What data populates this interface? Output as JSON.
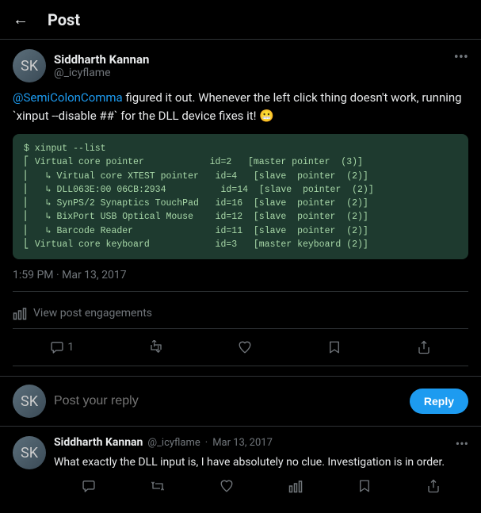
{
  "header": {
    "back_label": "←",
    "title": "Post"
  },
  "main_post": {
    "author": {
      "name": "Siddharth Kannan",
      "handle": "@_icyflame",
      "avatar_initial": "SK"
    },
    "more_icon": "•••",
    "content_prefix": "",
    "mention": "@SemiColonComma",
    "content_text": " figured it out. Whenever the left click thing doesn't work, running `xinput --disable ##` for the DLL device fixes it! 😬",
    "code": "$ xinput --list\n⎡ Virtual core pointer            id=2   [master pointer  (3)]\n⎜   ↳ Virtual core XTEST pointer   id=4   [slave  pointer  (2)]\n⎜   ↳ DLL063E:00 06CB:2934          id=14  [slave  pointer  (2)]\n⎜   ↳ SynPS/2 Synaptics TouchPad   id=16  [slave  pointer  (2)]\n⎜   ↳ BixPort USB Optical Mouse    id=12  [slave  pointer  (2)]\n⎜   ↳ Barcode Reader               id=11  [slave  pointer  (2)]\n⎣ Virtual core keyboard            id=3   [master keyboard (2)]",
    "timestamp": "1:59 PM · Mar 13, 2017",
    "engagements_label": "View post engagements",
    "actions": {
      "reply_count": "1",
      "retweet": "",
      "like": "",
      "bookmark": "",
      "share": ""
    }
  },
  "reply_section": {
    "placeholder": "Post your reply",
    "button_label": "Reply",
    "avatar_initial": "SK"
  },
  "comment": {
    "author_name": "Siddharth Kannan",
    "author_handle": "@_icyflame",
    "timestamp": "Mar 13, 2017",
    "more_icon": "•••",
    "text": "What exactly the DLL input is, I have absolutely no clue. Investigation is in order.",
    "avatar_initial": "SK"
  }
}
